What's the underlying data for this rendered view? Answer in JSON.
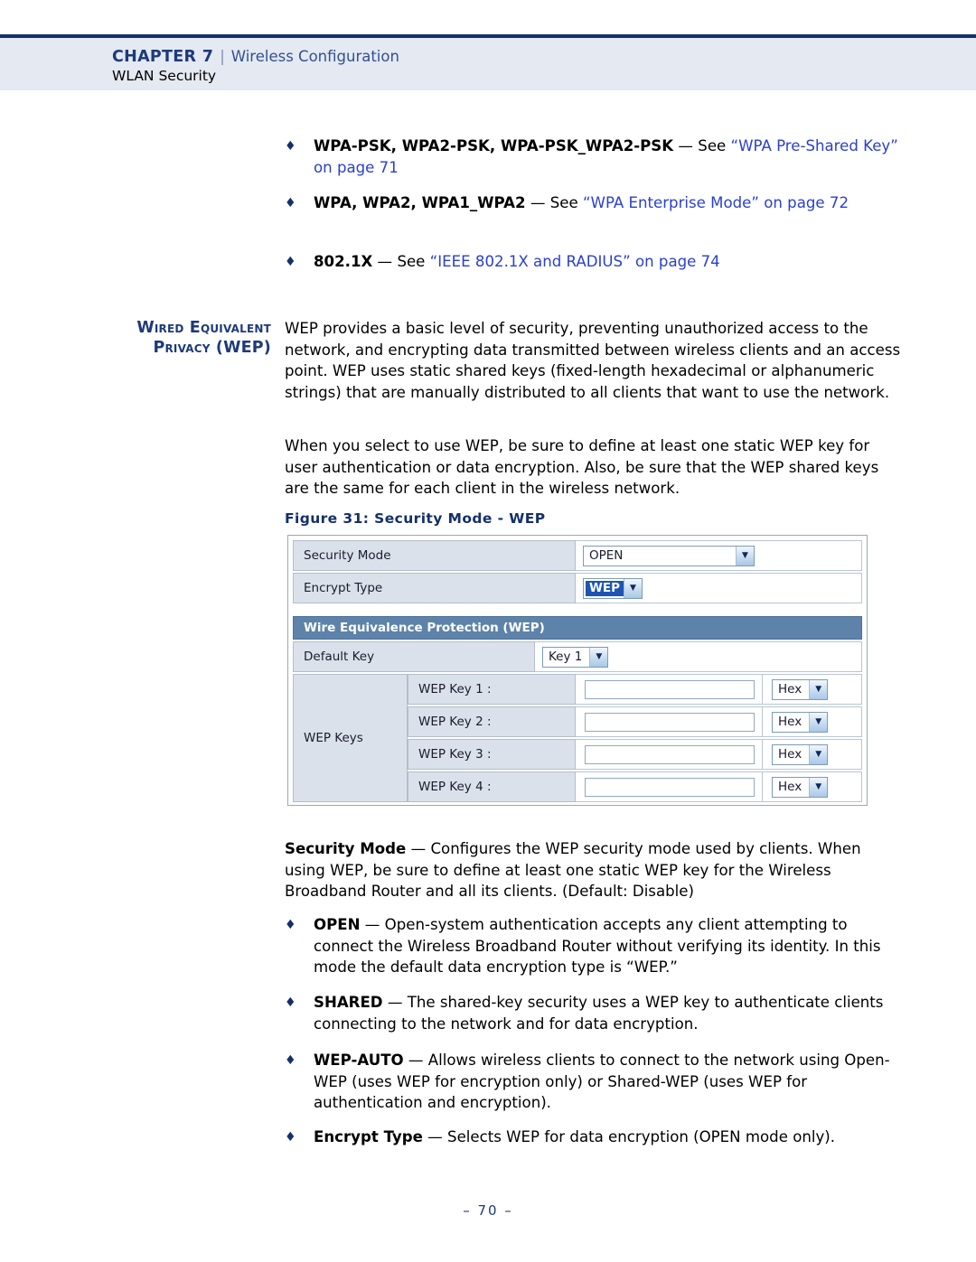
{
  "header": {
    "chapter": "CHAPTER 7",
    "separator": "|",
    "section": "Wireless Configuration",
    "subsection": "WLAN Security"
  },
  "top_bullets": [
    {
      "marker": "♦",
      "bold": "WPA-PSK, WPA2-PSK, WPA-PSK_WPA2-PSK",
      "dash": " — ",
      "plain": "See ",
      "link": "“WPA Pre-Shared Key” on page 71"
    },
    {
      "marker": "♦",
      "bold": "WPA, WPA2, WPA1_WPA2",
      "dash": " — ",
      "plain": "See ",
      "link": "“WPA Enterprise Mode” on page 72"
    },
    {
      "marker": "♦",
      "bold": "802.1X",
      "dash": " — ",
      "plain": "See ",
      "link": "“IEEE 802.1X and RADIUS” on page 74"
    }
  ],
  "side_heading": "Wired Equivalent Privacy (WEP)",
  "paragraphs": {
    "p1": "WEP provides a basic level of security, preventing unauthorized access to the network, and encrypting data transmitted between wireless clients and an access point. WEP uses static shared keys (fixed-length hexadecimal or alphanumeric strings) that are manually distributed to all clients that want to use the network.",
    "p2": "When you select to use WEP, be sure to define at least one static WEP key for user authentication or data encryption. Also, be sure that the WEP shared keys are the same for each client in the wireless network."
  },
  "figure_caption": "Figure 31:  Security Mode - WEP",
  "figure": {
    "rows": [
      {
        "label": "Security Mode",
        "value": "OPEN",
        "control": "select-wide"
      },
      {
        "label": "Encrypt Type",
        "value": "WEP",
        "control": "select-highlight"
      }
    ],
    "section_title": "Wire Equivalence Protection (WEP)",
    "default_key": {
      "label": "Default Key",
      "value": "Key 1"
    },
    "keys_label": "WEP Keys",
    "keys": [
      {
        "name": "WEP Key 1 :",
        "value": "",
        "type": "Hex"
      },
      {
        "name": "WEP Key 2 :",
        "value": "",
        "type": "Hex"
      },
      {
        "name": "WEP Key 3 :",
        "value": "",
        "type": "Hex"
      },
      {
        "name": "WEP Key 4 :",
        "value": "",
        "type": "Hex"
      }
    ],
    "arrow_glyph": "▼"
  },
  "security_mode_desc": {
    "bold": "Security Mode",
    "dash": " — ",
    "text": "Configures the WEP security mode used by clients. When using WEP, be sure to define at least one static WEP key for the Wireless Broadband Router and all its clients. (Default: Disable)"
  },
  "bottom_bullets": [
    {
      "marker": "♦",
      "bold": "OPEN",
      "dash": " — ",
      "text": "Open-system authentication accepts any client attempting to connect the Wireless Broadband Router without verifying its identity. In this mode the default data encryption type is “WEP.”"
    },
    {
      "marker": "♦",
      "bold": "SHARED",
      "dash": " — ",
      "text": "The shared-key security uses a WEP key to authenticate clients connecting to the network and for data encryption."
    },
    {
      "marker": "♦",
      "bold": "WEP-AUTO",
      "dash": " — ",
      "text": "Allows wireless clients to connect to the network using Open-WEP (uses WEP for encryption only) or Shared-WEP (uses WEP for authentication and encryption)."
    },
    {
      "marker": "♦",
      "bold": "Encrypt Type",
      "dash": " — ",
      "text": "Selects WEP for data encryption (OPEN mode only)."
    }
  ],
  "footer": {
    "page_number": "–  70  –"
  },
  "colors": {
    "header_band": "#e4e9f2",
    "navy": "#14306b",
    "link_blue": "#2a3fd0",
    "ui_section_bar": "#5e83aa",
    "ui_label_cell": "#dbe1ea",
    "selection_blue": "#1d55b3"
  }
}
